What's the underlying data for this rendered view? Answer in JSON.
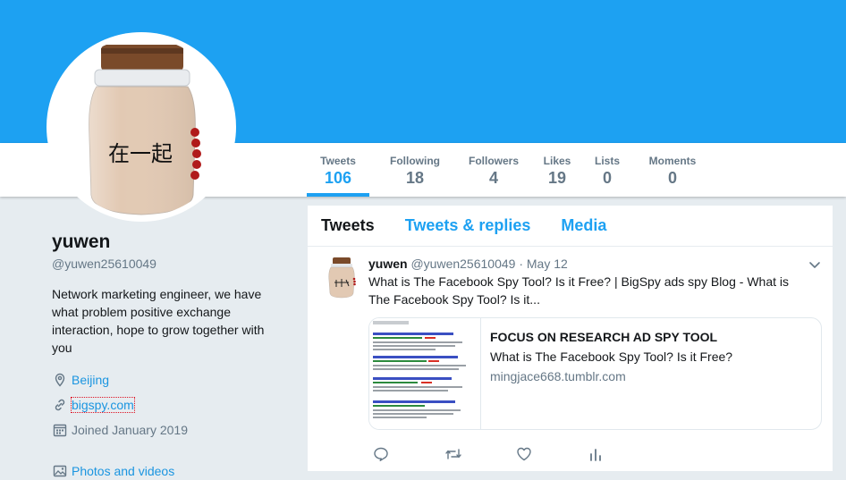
{
  "profile": {
    "name": "yuwen",
    "handle": "@yuwen25610049",
    "bio": "Network marketing engineer, we have what problem positive exchange interaction, hope to grow together with you",
    "location": "Beijing",
    "website": "bigspy.com",
    "joined": "Joined January 2019",
    "photos_link": "Photos and videos",
    "avatar_caption": "在一起"
  },
  "stats": [
    {
      "label": "Tweets",
      "value": "106"
    },
    {
      "label": "Following",
      "value": "18"
    },
    {
      "label": "Followers",
      "value": "4"
    },
    {
      "label": "Likes",
      "value": "19"
    },
    {
      "label": "Lists",
      "value": "0"
    },
    {
      "label": "Moments",
      "value": "0"
    }
  ],
  "timeline": {
    "tabs": [
      {
        "label": "Tweets"
      },
      {
        "label": "Tweets & replies"
      },
      {
        "label": "Media"
      }
    ],
    "tweet": {
      "name": "yuwen",
      "handle": "@yuwen25610049",
      "date": "· May 12",
      "text": "What is The Facebook Spy Tool? Is it Free? | BigSpy ads spy Blog - What is The Facebook Spy Tool? Is it...",
      "card": {
        "title": "FOCUS ON RESEARCH AD SPY TOOL",
        "description": "What is The Facebook Spy Tool? Is it Free?",
        "url": "mingjace668.tumblr.com"
      }
    }
  },
  "colors": {
    "accent": "#1da1f2",
    "text": "#14171a",
    "muted": "#657786",
    "background": "#e6ecf0"
  },
  "icons": [
    "location-icon",
    "link-icon",
    "calendar-icon",
    "photos-icon",
    "caret-down-icon",
    "reply-icon",
    "retweet-icon",
    "like-icon",
    "analytics-icon"
  ]
}
